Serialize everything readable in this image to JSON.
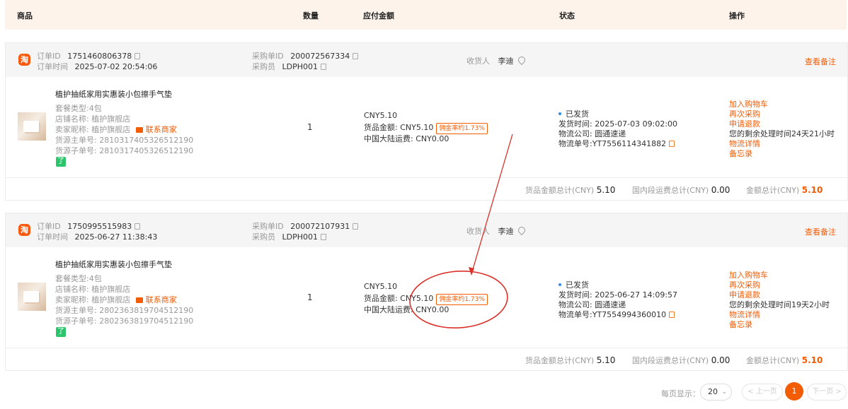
{
  "columns": {
    "product": "商品",
    "qty": "数量",
    "amount": "应付金额",
    "status": "状态",
    "action": "操作"
  },
  "labels": {
    "order_id": "订单ID",
    "order_time": "订单时间",
    "purchase_no": "采购单ID",
    "buyer": "采购员",
    "receiver": "收货人",
    "view_note": "查看备注",
    "package_type": "套餐类型:",
    "shop_name": "店铺名称:",
    "seller_name": "卖家昵称:",
    "contact_seller": "联系商家",
    "source_main": "货源主单号:",
    "source_sub": "货源子单号:",
    "goods_amount": "货品金额:",
    "domestic_shipping": "中国大陆运费:",
    "ship_time": "发货时间:",
    "logistics_company": "物流公司:",
    "tracking_no": "物流单号:",
    "goods_total": "货品金额总计(CNY)",
    "domestic_total": "国内段运费总计(CNY)",
    "grand_total": "金额总计(CNY)",
    "tao_icon": "淘",
    "green_icon": "了"
  },
  "orders": [
    {
      "order_id": "1751460806378",
      "order_time": "2025-07-02 20:54:06",
      "purchase_no": "200072567334",
      "buyer": "LDPH001",
      "receiver": "李迪",
      "product_title": "植护抽纸家用实惠装小包擦手气垫",
      "package_type": "4包",
      "shop_name": "植护旗舰店",
      "seller_name": "植护旗舰店",
      "source_main": "2810317405326512190",
      "source_sub": "2810317405326512190",
      "qty": "1",
      "amount": "CNY5.10",
      "goods_amount": "CNY5.10",
      "commission": "佣金率约1.73%",
      "domestic_shipping": "CNY0.00",
      "status": "已发货",
      "ship_time": "2025-07-03 09:02:00",
      "logistics_company": "圆通速递",
      "tracking_no": "YT7556114341882",
      "actions": [
        "加入购物车",
        "再次采购",
        "申请退款"
      ],
      "remaining_time": "您的剩余处理时间24天21小时",
      "actions_after": [
        "物流详情",
        "备忘录"
      ],
      "goods_total": "5.10",
      "domestic_total": "0.00",
      "grand_total": "5.10"
    },
    {
      "order_id": "1750995515983",
      "order_time": "2025-06-27 11:38:43",
      "purchase_no": "200072107931",
      "buyer": "LDPH001",
      "receiver": "李迪",
      "product_title": "植护抽纸家用实惠装小包擦手气垫",
      "package_type": "4包",
      "shop_name": "植护旗舰店",
      "seller_name": "植护旗舰店",
      "source_main": "2802363819704512190",
      "source_sub": "2802363819704512190",
      "qty": "1",
      "amount": "CNY5.10",
      "goods_amount": "CNY5.10",
      "commission": "佣金率约1.73%",
      "domestic_shipping": "CNY0.00",
      "status": "已发货",
      "ship_time": "2025-06-27 14:09:57",
      "logistics_company": "圆通速递",
      "tracking_no": "YT7554994360010",
      "actions": [
        "加入购物车",
        "再次采购",
        "申请退款"
      ],
      "remaining_time": "您的剩余处理时间19天2小时",
      "actions_after": [
        "物流详情",
        "备忘录"
      ],
      "goods_total": "5.10",
      "domestic_total": "0.00",
      "grand_total": "5.10"
    }
  ],
  "pagination": {
    "per_page_label": "每页显示：",
    "per_page": "20",
    "prev": "< 上一页",
    "current": "1",
    "next": "下一页 >"
  },
  "colors": {
    "accent": "#f25c05",
    "annotation": "#d9322b"
  }
}
